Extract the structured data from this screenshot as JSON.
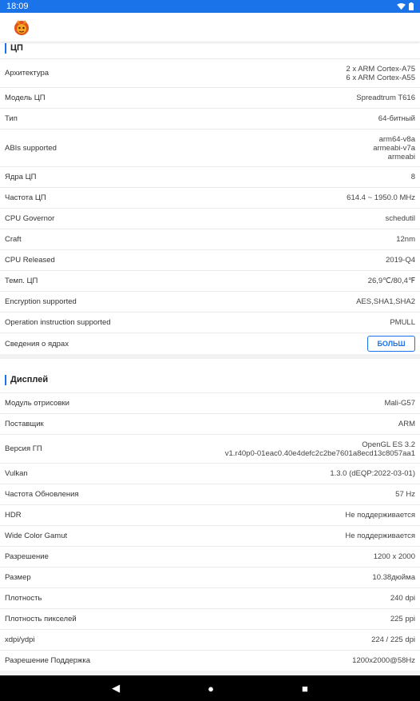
{
  "status": {
    "time": "18:09",
    "icons": [
      "wifi-icon",
      "battery-icon"
    ]
  },
  "app": {
    "logo": "antutu-logo"
  },
  "cpu": {
    "title": "ЦП",
    "rows": [
      {
        "label": "Архитектура",
        "value_lines": [
          "2 x ARM Cortex-A75",
          "6 x ARM Cortex-A55"
        ]
      },
      {
        "label": "Модель ЦП",
        "value": "Spreadtrum T616"
      },
      {
        "label": "Тип",
        "value": "64-битный"
      },
      {
        "label": "ABIs supported",
        "value_lines": [
          "arm64-v8a",
          "armeabi-v7a",
          "armeabi"
        ]
      },
      {
        "label": "Ядра ЦП",
        "value": "8"
      },
      {
        "label": "Частота ЦП",
        "value": "614.4 ~ 1950.0 MHz"
      },
      {
        "label": "CPU Governor",
        "value": "schedutil"
      },
      {
        "label": "Craft",
        "value": "12nm"
      },
      {
        "label": "CPU Released",
        "value": "2019-Q4"
      },
      {
        "label": "Темп. ЦП",
        "value": "26,9℃/80,4℉"
      },
      {
        "label": "Encryption supported",
        "value": "AES,SHA1,SHA2"
      },
      {
        "label": "Operation instruction supported",
        "value": "PMULL"
      },
      {
        "label": "Сведения о ядрах",
        "button": "БОЛЬШ"
      }
    ]
  },
  "display": {
    "title": "Дисплей",
    "rows": [
      {
        "label": "Модуль отрисовки",
        "value": "Mali-G57"
      },
      {
        "label": "Поставщик",
        "value": "ARM"
      },
      {
        "label": "Версия ГП",
        "value_lines": [
          "OpenGL ES 3.2",
          "v1.r40p0-01eac0.40e4defc2c2be7601a8ecd13c8057aa1"
        ]
      },
      {
        "label": "Vulkan",
        "value": "1.3.0 (dEQP:2022-03-01)"
      },
      {
        "label": "Частота Обновления",
        "value": "57 Hz"
      },
      {
        "label": "HDR",
        "value": "Не поддерживается"
      },
      {
        "label": "Wide Color Gamut",
        "value": "Не поддерживается"
      },
      {
        "label": "Разрешение",
        "value": "1200 x 2000"
      },
      {
        "label": "Размер",
        "value": "10.38дюйма"
      },
      {
        "label": "Плотность",
        "value": "240 dpi"
      },
      {
        "label": "Плотность пикселей",
        "value": "225 ppi"
      },
      {
        "label": "xdpi/ydpi",
        "value": "224 / 225 dpi"
      },
      {
        "label": "Разрешение Поддержка",
        "value": "1200x2000@58Hz"
      }
    ]
  },
  "nav": {
    "back": "◀",
    "home": "●",
    "recents": "■"
  }
}
